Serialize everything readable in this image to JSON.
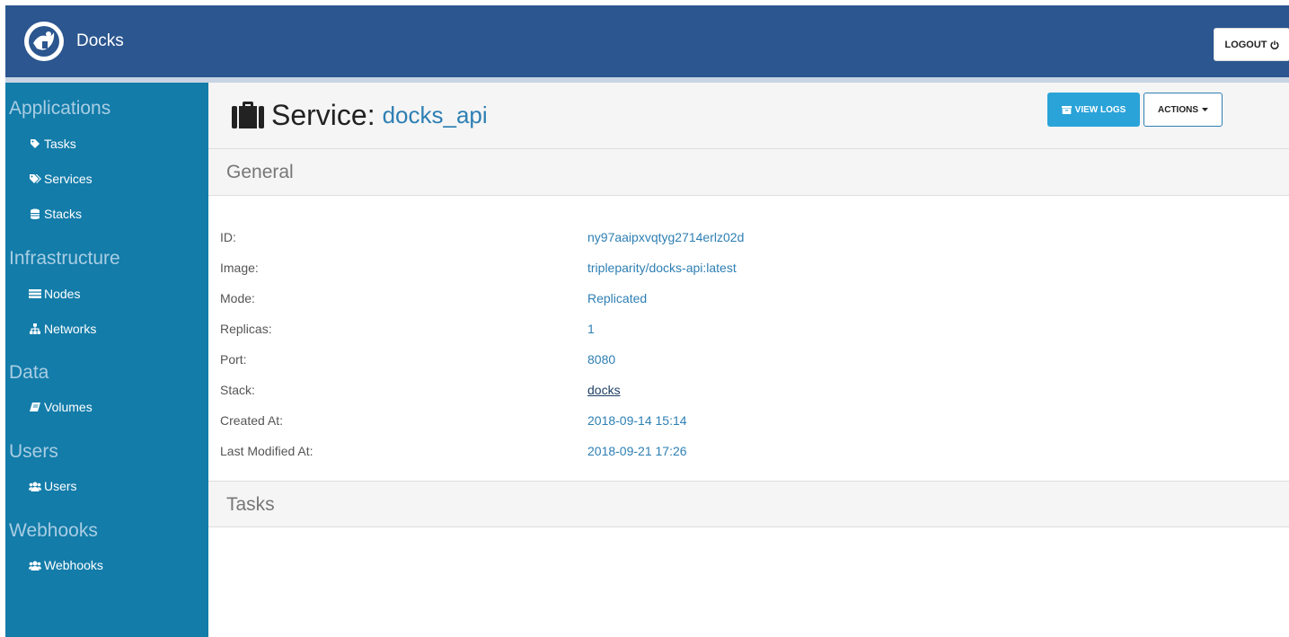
{
  "app": {
    "name": "Docks",
    "logout_label": "LOGOUT"
  },
  "sidebar": {
    "sections": [
      {
        "title": "Applications",
        "items": [
          {
            "label": "Tasks",
            "icon": "tag-icon"
          },
          {
            "label": "Services",
            "icon": "tags-icon"
          },
          {
            "label": "Stacks",
            "icon": "database-icon"
          }
        ]
      },
      {
        "title": "Infrastructure",
        "items": [
          {
            "label": "Nodes",
            "icon": "server-icon"
          },
          {
            "label": "Networks",
            "icon": "sitemap-icon"
          }
        ]
      },
      {
        "title": "Data",
        "items": [
          {
            "label": "Volumes",
            "icon": "book-icon"
          }
        ]
      },
      {
        "title": "Users",
        "items": [
          {
            "label": "Users",
            "icon": "users-icon"
          }
        ]
      },
      {
        "title": "Webhooks",
        "items": [
          {
            "label": "Webhooks",
            "icon": "users-icon"
          }
        ]
      }
    ]
  },
  "page": {
    "title_prefix": "Service:",
    "service_name": "docks_api",
    "view_logs_label": "VIEW LOGS",
    "actions_label": "ACTIONS"
  },
  "general": {
    "header": "General",
    "rows": [
      {
        "label": "ID:",
        "value": "ny97aaipxvqtyg2714erlz02d"
      },
      {
        "label": "Image:",
        "value": "tripleparity/docks-api:latest"
      },
      {
        "label": "Mode:",
        "value": "Replicated"
      },
      {
        "label": "Replicas:",
        "value": "1"
      },
      {
        "label": "Port:",
        "value": "8080"
      },
      {
        "label": "Stack:",
        "value": "docks"
      },
      {
        "label": "Created At:",
        "value": "2018-09-14 15:14"
      },
      {
        "label": "Last Modified At:",
        "value": "2018-09-21 17:26"
      }
    ]
  },
  "tasks": {
    "header": "Tasks"
  },
  "colors": {
    "topbar": "#2b568f",
    "sidebar": "#137ca9",
    "accent": "#2e7fb3",
    "view_logs_button": "#2aa3d8"
  }
}
